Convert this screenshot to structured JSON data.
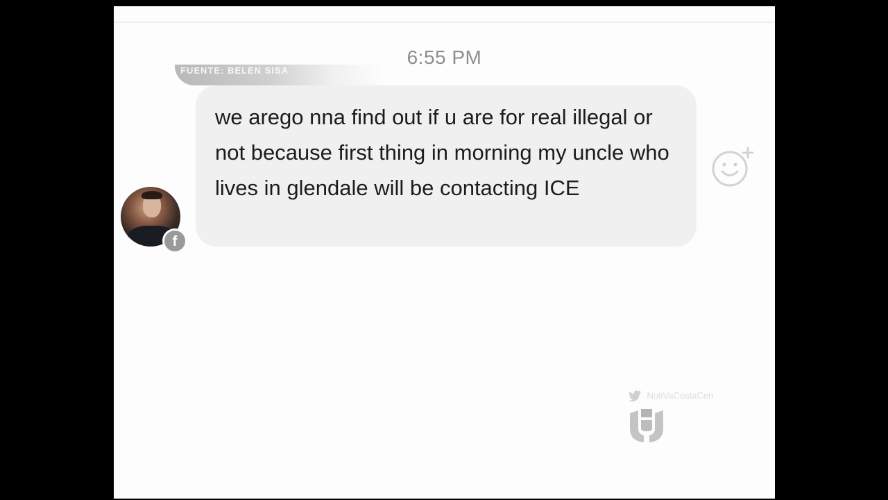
{
  "chat": {
    "timestamp": "6:55 PM",
    "message": "we arego nna find out if u are for real illegal or not because first thing in morning my uncle who lives in glendale will be contacting ICE",
    "sender_avatar_icon": "avatar-photo",
    "badge_icon": "facebook-icon",
    "reaction_icon": "add-reaction-icon"
  },
  "overlay": {
    "source_label": "FUENTE: BELEN SISA",
    "watermark_handle": "NotiVaCostaCen",
    "watermark_icon": "twitter-bird-icon",
    "watermark_logo_icon": "univision-logo-icon"
  },
  "colors": {
    "bubble": "#f0f0f0",
    "text": "#1c1c1c",
    "timestamp": "#8d8d8d",
    "background": "#fdfdfd"
  }
}
